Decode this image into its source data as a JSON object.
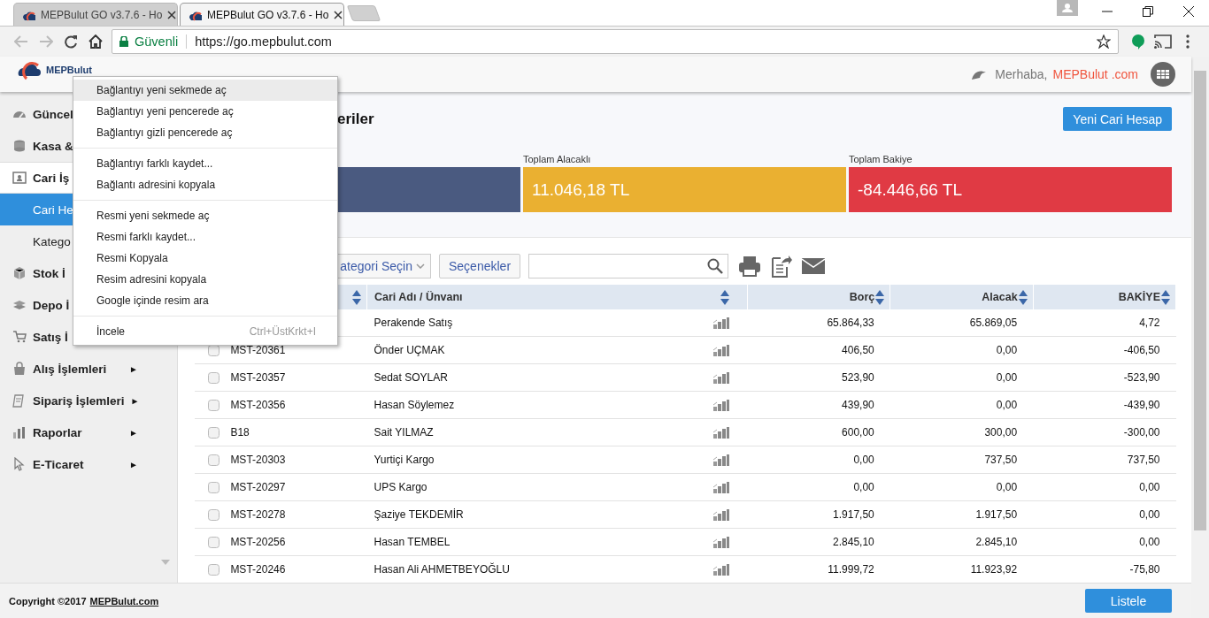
{
  "browser": {
    "tabs": [
      {
        "title": "MEPBulut GO v3.7.6 - Ho",
        "selected": false
      },
      {
        "title": "MEPBulut GO v3.7.6 - Ho",
        "selected": true
      }
    ],
    "security_label": "Güvenli",
    "url": "https://go.mepbulut.com"
  },
  "header": {
    "logo_text": "MEPBulut",
    "greeting": "Merhaba,",
    "user": "MEPBulut .com"
  },
  "sidebar": {
    "items": [
      {
        "label": "Güncel",
        "expanded": false
      },
      {
        "label": "Kasa &",
        "expanded": false
      },
      {
        "label": "Cari İş",
        "expanded": true,
        "children": [
          {
            "label": "Cari He",
            "selected": true
          },
          {
            "label": "Katego",
            "selected": false
          }
        ]
      },
      {
        "label": "Stok İ",
        "expanded": false
      },
      {
        "label": "Depo İ",
        "expanded": false
      },
      {
        "label": "Satış İ",
        "expanded": false
      },
      {
        "label": "Alış İşlemleri",
        "expanded": false,
        "arrow": "►"
      },
      {
        "label": "Sipariş İşlemleri",
        "expanded": false,
        "arrow": "►"
      },
      {
        "label": "Raporlar",
        "expanded": false,
        "arrow": "►"
      },
      {
        "label": "E-Ticaret",
        "expanded": false,
        "arrow": "►"
      }
    ]
  },
  "page": {
    "title": "eriler",
    "new_button": "Yeni Cari Hesap",
    "cards": [
      {
        "color": "#4a5a80"
      },
      {
        "label": "Toplam Alacaklı",
        "value": "11.046,18 TL",
        "color": "#eab031"
      },
      {
        "label": "Toplam Bakiye",
        "value": "-84.446,66 TL",
        "color": "#e03a44"
      }
    ],
    "category_select": "ategori Seçin",
    "options_button": "Seçenekler"
  },
  "table": {
    "columns": [
      {
        "label": "Cari Adı / Ünvanı"
      },
      {
        "label": "Borç"
      },
      {
        "label": "Alacak"
      },
      {
        "label": "BAKİYE"
      }
    ],
    "rows": [
      {
        "name": "Perakende Satış",
        "borc": "65.864,33",
        "alacak": "65.869,05",
        "bakiye": "4,72"
      },
      {
        "code": "MST-20361",
        "name": "Önder UÇMAK",
        "borc": "406,50",
        "alacak": "0,00",
        "bakiye": "-406,50",
        "checked": false
      },
      {
        "code": "MST-20357",
        "name": "Sedat SOYLAR",
        "borc": "523,90",
        "alacak": "0,00",
        "bakiye": "-523,90",
        "checked": false
      },
      {
        "code": "MST-20356",
        "name": "Hasan Söylemez",
        "borc": "439,90",
        "alacak": "0,00",
        "bakiye": "-439,90",
        "checked": false
      },
      {
        "code": "B18",
        "name": "Sait YILMAZ",
        "borc": "600,00",
        "alacak": "300,00",
        "bakiye": "-300,00",
        "checked": false
      },
      {
        "code": "MST-20303",
        "name": "Yurtiçi Kargo",
        "borc": "0,00",
        "alacak": "737,50",
        "bakiye": "737,50",
        "checked": false
      },
      {
        "code": "MST-20297",
        "name": "UPS Kargo",
        "borc": "0,00",
        "alacak": "0,00",
        "bakiye": "0,00",
        "checked": false
      },
      {
        "code": "MST-20278",
        "name": "Şaziye TEKDEMİR",
        "borc": "1.917,50",
        "alacak": "1.917,50",
        "bakiye": "0,00",
        "checked": false
      },
      {
        "code": "MST-20256",
        "name": "Hasan TEMBEL",
        "borc": "2.845,10",
        "alacak": "2.845,10",
        "bakiye": "0,00",
        "checked": false
      },
      {
        "code": "MST-20246",
        "name": "Hasan Ali AHMETBEYOĞLU",
        "borc": "11.999,72",
        "alacak": "11.923,92",
        "bakiye": "-75,80",
        "checked": false
      }
    ]
  },
  "footer": {
    "copyright": "Copyright ©2017",
    "link": "MEPBulut.com",
    "list_button": "Listele"
  },
  "context_menu": {
    "groups": [
      [
        {
          "label": "Bağlantıyı yeni sekmede aç",
          "selected": true
        },
        {
          "label": "Bağlantıyı yeni pencerede aç",
          "selected": false
        },
        {
          "label": "Bağlantıyı gizli pencerede aç",
          "selected": false
        }
      ],
      [
        {
          "label": "Bağlantıyı farklı kaydet...",
          "selected": false
        },
        {
          "label": "Bağlantı adresini kopyala",
          "selected": false
        }
      ],
      [
        {
          "label": "Resmi yeni sekmede aç",
          "selected": false
        },
        {
          "label": "Resmi farklı kaydet...",
          "selected": false
        },
        {
          "label": "Resmi Kopyala",
          "selected": false
        },
        {
          "label": "Resim adresini kopyala",
          "selected": false
        },
        {
          "label": "Google içinde resim ara",
          "selected": false
        }
      ],
      [
        {
          "label": "İncele",
          "shortcut": "Ctrl+ÜstKrkt+I",
          "selected": false
        }
      ]
    ]
  }
}
